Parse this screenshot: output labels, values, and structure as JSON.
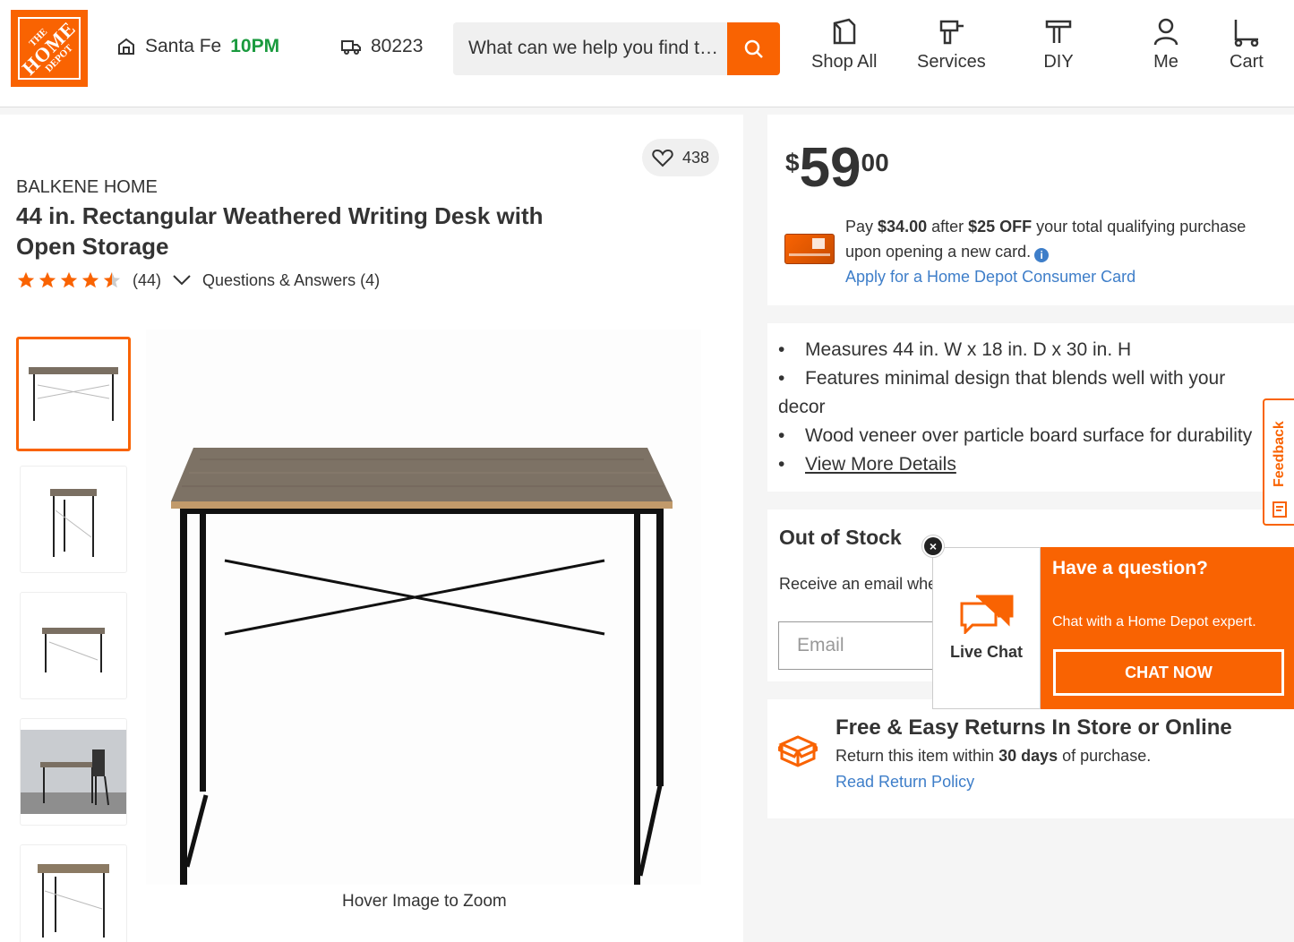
{
  "header": {
    "logo_lines": [
      "THE",
      "HOME",
      "DEPOT"
    ],
    "store_name": "Santa Fe",
    "store_hours": "10PM",
    "zip": "80223",
    "search_placeholder": "What can we help you find today?",
    "nav": [
      {
        "label": "Shop All",
        "icon": "shop-all-icon"
      },
      {
        "label": "Services",
        "icon": "services-drill-icon"
      },
      {
        "label": "DIY",
        "icon": "diy-hammer-icon"
      },
      {
        "label": "Me",
        "icon": "user-icon"
      },
      {
        "label": "Cart",
        "icon": "cart-icon"
      }
    ]
  },
  "product": {
    "favorites_count": "438",
    "brand": "BALKENE HOME",
    "title": "44 in. Rectangular Weathered Writing Desk with Open Storage",
    "rating": 4.5,
    "review_count": "(44)",
    "qa_label": "Questions & Answers (4)",
    "zoom_hint": "Hover Image to Zoom",
    "thumbnails_count": 5
  },
  "price": {
    "currency": "$",
    "dollars": "59",
    "cents": "00",
    "offer_prefix": "Pay ",
    "offer_amount": "$34.00",
    "offer_mid": " after ",
    "offer_discount": "$25 OFF",
    "offer_suffix": " your total qualifying purchase upon opening a new card.",
    "apply_link": "Apply for a Home Depot Consumer Card"
  },
  "bullets": {
    "b1": "Measures 44 in. W x 18 in. D x 30 in. H",
    "b2a": "Features minimal design that blends well with your",
    "b2b": "decor",
    "b3": "Wood veneer over particle board surface for durability",
    "b4": "View More Details"
  },
  "stock": {
    "title": "Out of Stock",
    "desc": "Receive an email when it's back in stock",
    "email_placeholder": "Email"
  },
  "returns": {
    "title": "Free & Easy Returns In Store or Online",
    "desc_prefix": "Return this item within ",
    "desc_days": "30 days",
    "desc_suffix": " of purchase.",
    "link": "Read Return Policy"
  },
  "chat": {
    "live_chat": "Live Chat",
    "question": "Have a question?",
    "sub": "Chat with a Home Depot expert.",
    "cta": "CHAT NOW",
    "close": "×"
  },
  "feedback": {
    "label": "Feedback"
  },
  "colors": {
    "brand_orange": "#f96302",
    "hours_green": "#1a9a3e",
    "link_blue": "#3e7ec9"
  }
}
